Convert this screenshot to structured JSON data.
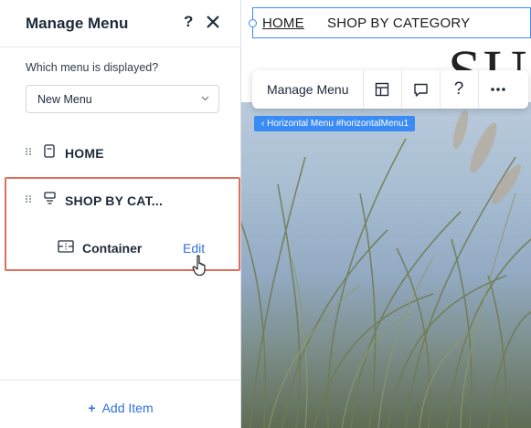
{
  "panel": {
    "title": "Manage Menu",
    "help": "?",
    "field_label": "Which menu is displayed?",
    "selected_menu": "New Menu",
    "items": [
      {
        "label": "HOME"
      },
      {
        "label": "SHOP BY CAT..."
      }
    ],
    "sub_item": {
      "label": "Container",
      "action": "Edit"
    },
    "add_item": "Add Item",
    "add_item_plus": "+"
  },
  "site": {
    "nav": [
      "HOME",
      "SHOP BY CATEGORY"
    ],
    "hero_text": "SU"
  },
  "toolbar": {
    "label": "Manage Menu",
    "help": "?",
    "more": "..."
  },
  "breadcrumb": "Horizontal Menu #horizontalMenu1",
  "colors": {
    "accent": "#3b8bf5",
    "link": "#2f6fde",
    "highlight": "#e26f5d"
  }
}
